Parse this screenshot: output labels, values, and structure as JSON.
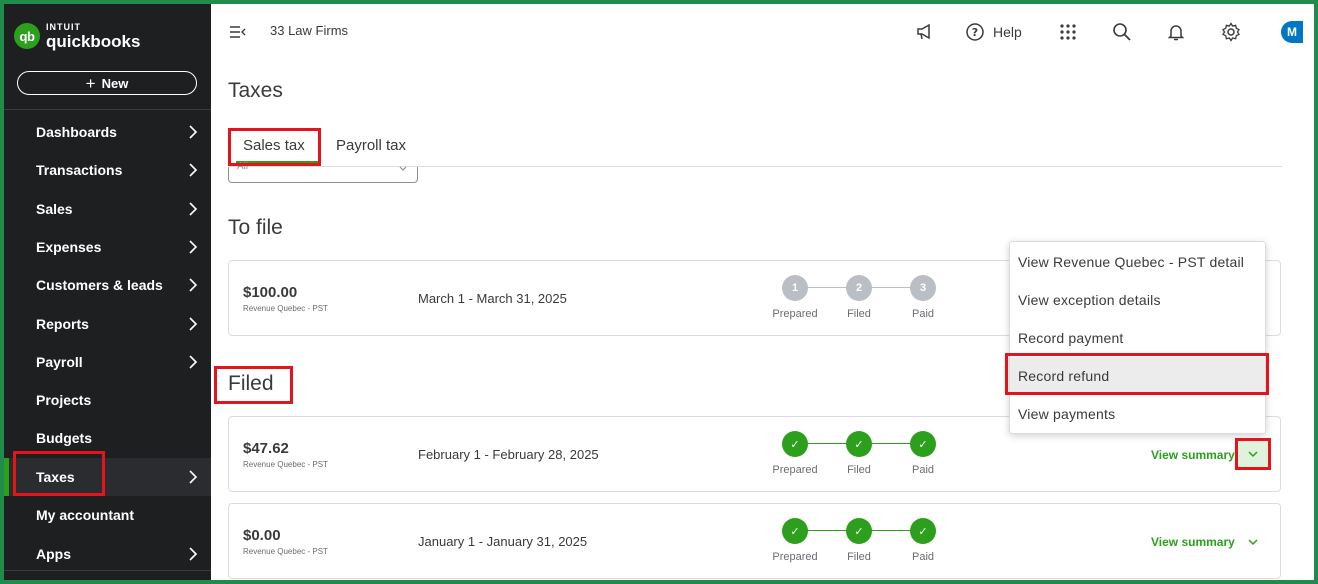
{
  "app": {
    "logo_brand": "INTUIT",
    "logo_product": "quickbooks",
    "logo_badge": "qb"
  },
  "sidebar": {
    "new_label": "New",
    "items": [
      {
        "label": "Dashboards",
        "chevron": true
      },
      {
        "label": "Transactions",
        "chevron": true
      },
      {
        "label": "Sales",
        "chevron": true
      },
      {
        "label": "Expenses",
        "chevron": true
      },
      {
        "label": "Customers & leads",
        "chevron": true
      },
      {
        "label": "Reports",
        "chevron": true
      },
      {
        "label": "Payroll",
        "chevron": true
      },
      {
        "label": "Projects",
        "chevron": false
      },
      {
        "label": "Budgets",
        "chevron": false
      },
      {
        "label": "Taxes",
        "chevron": true,
        "active": true
      },
      {
        "label": "My accountant",
        "chevron": false
      },
      {
        "label": "Apps",
        "chevron": true
      }
    ]
  },
  "topbar": {
    "company": "33 Law Firms",
    "help_label": "Help",
    "avatar_initial": "M",
    "icons": [
      "announcement-icon",
      "help-icon",
      "apps-grid-icon",
      "search-icon",
      "bell-icon",
      "gear-icon"
    ]
  },
  "page": {
    "title": "Taxes",
    "tabs": [
      {
        "label": "Sales tax",
        "active": true
      },
      {
        "label": "Payroll tax",
        "active": false
      }
    ],
    "filter_text": "All"
  },
  "to_file": {
    "title": "To file",
    "rows": [
      {
        "amount": "$100.00",
        "agency": "Revenue Quebec - PST",
        "period": "March 1 - March 31, 2025",
        "steps": [
          {
            "num": "1",
            "label": "Prepared",
            "done": false
          },
          {
            "num": "2",
            "label": "Filed",
            "done": false
          },
          {
            "num": "3",
            "label": "Paid",
            "done": false
          }
        ]
      }
    ]
  },
  "filed": {
    "title": "Filed",
    "rows": [
      {
        "amount": "$47.62",
        "agency": "Revenue Quebec - PST",
        "period": "February 1 - February 28, 2025",
        "action": "View summary",
        "steps": [
          {
            "num": "✓",
            "label": "Prepared",
            "done": true
          },
          {
            "num": "✓",
            "label": "Filed",
            "done": true
          },
          {
            "num": "✓",
            "label": "Paid",
            "done": true
          }
        ]
      },
      {
        "amount": "$0.00",
        "agency": "Revenue Quebec - PST",
        "period": "January 1 - January 31, 2025",
        "action": "View summary",
        "steps": [
          {
            "num": "✓",
            "label": "Prepared",
            "done": true
          },
          {
            "num": "✓",
            "label": "Filed",
            "done": true
          },
          {
            "num": "✓",
            "label": "Paid",
            "done": true
          }
        ]
      }
    ]
  },
  "dropdown": {
    "items": [
      "View Revenue Quebec - PST detail",
      "View exception details",
      "Record payment",
      "Record refund",
      "View payments"
    ]
  },
  "colors": {
    "brand_green": "#2ca01c",
    "sidebar_bg": "#1e1f21",
    "highlight_red": "#e3141b",
    "frame_green": "#1f8c4b"
  }
}
